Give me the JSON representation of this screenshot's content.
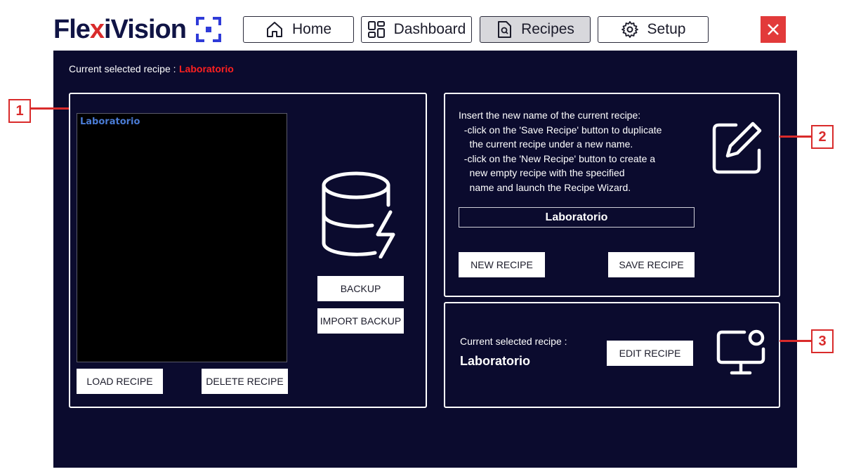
{
  "app": {
    "logo_text_1": "Fle",
    "logo_text_x": "x",
    "logo_text_2": "iVision"
  },
  "nav": {
    "items": [
      {
        "label": "Home",
        "icon": "home-icon",
        "active": false
      },
      {
        "label": "Dashboard",
        "icon": "dashboard-icon",
        "active": false
      },
      {
        "label": "Recipes",
        "icon": "recipes-icon",
        "active": true
      },
      {
        "label": "Setup",
        "icon": "gear-icon",
        "active": false
      }
    ],
    "close_icon": "close-icon"
  },
  "header": {
    "selected_label": "Current selected recipe :",
    "selected_value": "Laboratorio"
  },
  "section1": {
    "recipes": [
      "Laboratorio"
    ],
    "load_label": "LOAD RECIPE",
    "delete_label": "DELETE RECIPE",
    "backup_label": "BACKUP",
    "import_label": "IMPORT BACKUP",
    "icon": "database-icon"
  },
  "section2": {
    "instructions": "Insert the new name of the current recipe:\n  -click on the 'Save Recipe' button to duplicate\n    the current recipe under a new name.\n  -click on the 'New Recipe' button to create a\n    new empty recipe with the specified\n    name and launch the Recipe Wizard.",
    "name_value": "Laboratorio",
    "new_label": "NEW RECIPE",
    "save_label": "SAVE RECIPE",
    "icon": "edit-icon"
  },
  "section3": {
    "current_label": "Current selected recipe :",
    "current_value": "Laboratorio",
    "edit_label": "EDIT RECIPE",
    "icon": "monitor-settings-icon"
  },
  "callouts": [
    "1",
    "2",
    "3"
  ],
  "colors": {
    "panel_bg": "#0b0b2e",
    "accent_red": "#d92b2b",
    "list_text": "#4a7bd4",
    "logo_blue": "#101445",
    "logo_mark": "#2f3bd8"
  }
}
